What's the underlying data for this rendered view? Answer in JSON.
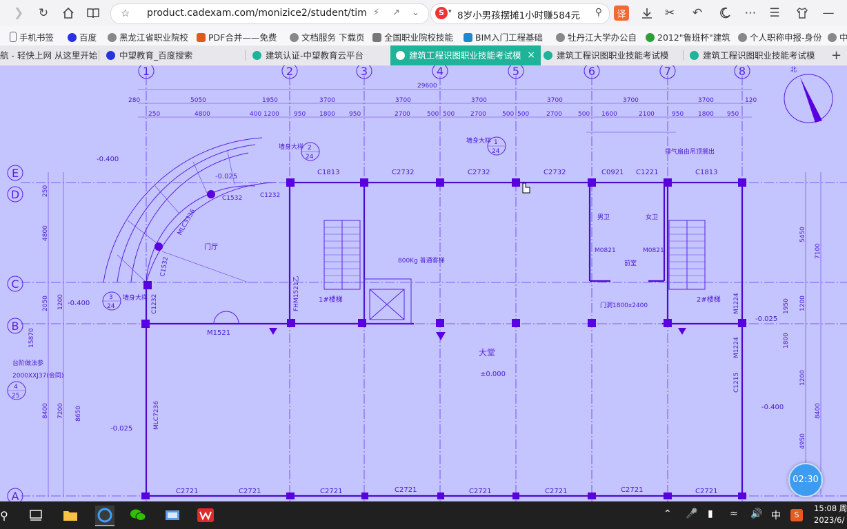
{
  "toolbar": {
    "url": "product.cadexam.com/monizice2/student/tim",
    "search_text": "8岁小男孩摆摊1小时赚584元",
    "search_engine_badge": "S",
    "translate_label": "译"
  },
  "bookmarks": [
    {
      "label": "手机书签",
      "icon": "phone-icon",
      "color": "#666666"
    },
    {
      "label": "百度",
      "icon": "baidu-paw-icon",
      "color": "#2932e1"
    },
    {
      "label": "黑龙江省职业院校",
      "icon": "globe-icon",
      "color": "#888888"
    },
    {
      "label": "PDF合并——免费",
      "icon": "pdf-icon",
      "color": "#e05a1a"
    },
    {
      "label": "文档服务 下载页",
      "icon": "globe-icon",
      "color": "#888888"
    },
    {
      "label": "全国职业院校技能",
      "icon": "doc-icon",
      "color": "#777777"
    },
    {
      "label": "BIM入门工程基础",
      "icon": "bim-icon",
      "color": "#1e88c8"
    },
    {
      "label": "牡丹江大学办公自",
      "icon": "globe-icon",
      "color": "#888888"
    },
    {
      "label": "2012\"鲁班杯\"建筑",
      "icon": "badge-16-icon",
      "color": "#2e9e3a"
    },
    {
      "label": "个人职称申报-身份",
      "icon": "globe-icon",
      "color": "#888888"
    },
    {
      "label": "中",
      "icon": "globe-icon",
      "color": "#888888"
    }
  ],
  "tabs": [
    {
      "label": "航 - 轻快上网 从这里开始",
      "icon": "none",
      "color": "#e8e8ec",
      "active": false
    },
    {
      "label": "中望教育_百度搜索",
      "icon": "baidu-paw-icon",
      "color": "#2932e1",
      "active": false
    },
    {
      "label": "建筑认证-中望教育云平台",
      "icon": "zw-icon",
      "color": "#1fb39a",
      "active": false
    },
    {
      "label": "建筑工程识图职业技能考试模",
      "icon": "zw-icon",
      "color": "#ffffff",
      "active": true,
      "close": "×"
    },
    {
      "label": "建筑工程识图职业技能考试模",
      "icon": "zw-icon",
      "color": "#1fb39a",
      "active": false
    },
    {
      "label": "建筑工程识图职业技能考试模",
      "icon": "zw-icon",
      "color": "#1fb39a",
      "active": false
    }
  ],
  "new_tab_label": "+",
  "drawing": {
    "axis_numbers": [
      "1",
      "2",
      "3",
      "4",
      "5",
      "6",
      "7",
      "8"
    ],
    "axis_letters": [
      "E",
      "D",
      "C",
      "B",
      "A"
    ],
    "top_dims_row1": [
      "280",
      "5050",
      "1950",
      "3700",
      "3700",
      "3700",
      "3700",
      "3700",
      "3700",
      "120"
    ],
    "overall_dim": "29600",
    "top_dims_row2": [
      "250",
      "4800",
      "400",
      "1200",
      "950",
      "1800",
      "950",
      "2700",
      "500",
      "500",
      "2700",
      "500",
      "500",
      "2700",
      "500",
      "1600",
      "2100",
      "950",
      "1800",
      "950"
    ],
    "windows_top": [
      "C1813",
      "C2732",
      "C2732",
      "C2732",
      "C0921",
      "C1221",
      "C1813"
    ],
    "windows_bottom": [
      "C2721",
      "C2721",
      "C2721",
      "C2721",
      "C2721",
      "C2721",
      "C2721",
      "C2721"
    ],
    "room_labels": [
      "门厅",
      "1#楼梯",
      "2#楼梯",
      "大堂",
      "男卫",
      "女卫",
      "前室",
      "800Kg 普通客梯",
      "排气扇由吊顶搁出"
    ],
    "door_labels": [
      "M1521",
      "M0821",
      "M0821",
      "M1224",
      "M1224",
      "门洞1800x2400",
      "FHM1521乙"
    ],
    "misc_labels": [
      "MLC3336",
      "C1532",
      "C1232",
      "C1532",
      "C1232",
      "MLC7236",
      "C1215",
      "墙身大样",
      "墙身大样",
      "墙身大样",
      "台阶做法参",
      "2000XXJ37(会同)"
    ],
    "elevations": [
      "-0.400",
      "-0.025",
      "-0.400",
      "±0.000",
      "-0.025",
      "-0.400",
      "-0.025"
    ],
    "left_dims": [
      "250",
      "4800",
      "2050",
      "1200",
      "15870",
      "8400",
      "7200",
      "8650"
    ],
    "right_dims": [
      "5450",
      "7100",
      "1950",
      "1200",
      "1800",
      "1200",
      "8400",
      "4950"
    ],
    "detail_refs": [
      {
        "num": "2",
        "den": "24"
      },
      {
        "num": "1",
        "den": "24"
      },
      {
        "num": "3",
        "den": "24"
      },
      {
        "num": "4",
        "den": "25"
      }
    ]
  },
  "timer": {
    "label": "02:30"
  },
  "taskbar": {
    "ime": "中",
    "time": "15:08 周",
    "date": "2023/6/"
  }
}
